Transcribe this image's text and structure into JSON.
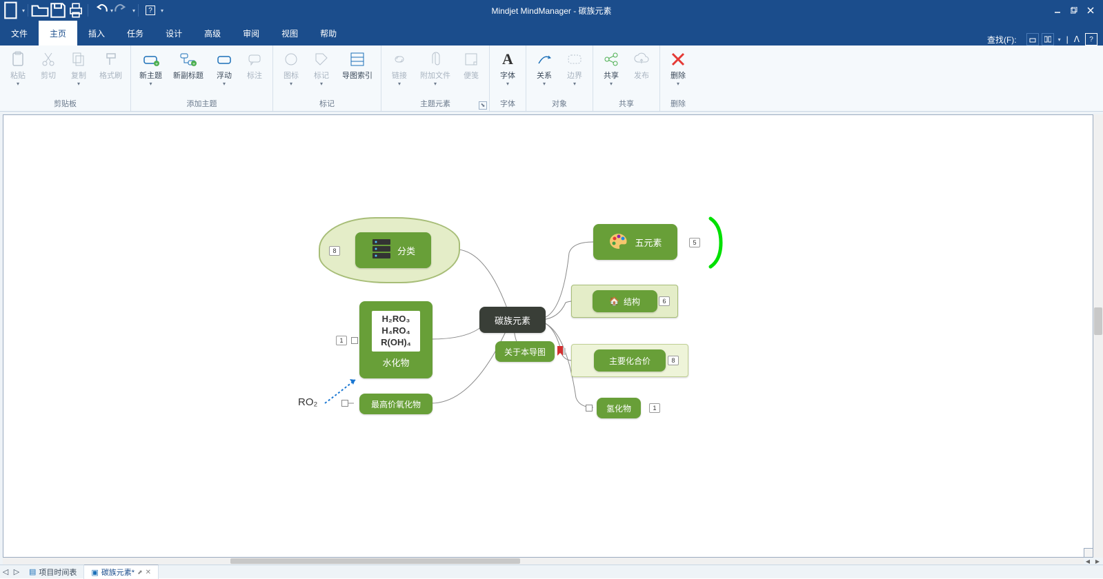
{
  "app": {
    "title": "Mindjet MindManager - 碳族元素"
  },
  "menu": {
    "file": "文件",
    "home": "主页",
    "insert": "插入",
    "task": "任务",
    "design": "设计",
    "advanced": "高级",
    "review": "审阅",
    "view": "视图",
    "help": "帮助",
    "find": "查找(F):"
  },
  "ribbon": {
    "groups": {
      "clipboard": {
        "label": "剪贴板",
        "paste": "粘贴",
        "cut": "剪切",
        "copy": "复制",
        "fmt": "格式刷"
      },
      "addTopic": {
        "label": "添加主题",
        "newTopic": "新主题",
        "newSub": "新副标题",
        "float": "浮动",
        "callout": "标注"
      },
      "marker": {
        "label": "标记",
        "icon": "图标",
        "tag": "标记",
        "mapIndex": "导图索引"
      },
      "topicEl": {
        "label": "主题元素",
        "link": "链接",
        "attach": "附加文件",
        "note": "便笺"
      },
      "font": {
        "label": "字体",
        "font": "字体"
      },
      "object": {
        "label": "对象",
        "relation": "关系",
        "boundary": "边界"
      },
      "share": {
        "label": "共享",
        "share": "共享",
        "publish": "发布"
      },
      "delete": {
        "label": "删除",
        "delete": "删除"
      }
    }
  },
  "map": {
    "central": "碳族元素",
    "about": "关于本导图",
    "category": "分类",
    "categoryBadge": "8",
    "hydrate": {
      "title": "水化物",
      "f1": "H₂RO₃",
      "f2": "H₄RO₄",
      "f3": "R(OH)₄",
      "badge": "1"
    },
    "highest": "最高价氧化物",
    "ro2": "RO₂",
    "five": {
      "label": "五元素",
      "badge": "5"
    },
    "structure": {
      "label": "结构",
      "badge": "6"
    },
    "valence": {
      "label": "主要化合价",
      "badge": "8"
    },
    "hydride": {
      "label": "氢化物",
      "badge": "1"
    }
  },
  "tabs": {
    "timeline": "项目时间表",
    "doc": "碳族元素*"
  }
}
